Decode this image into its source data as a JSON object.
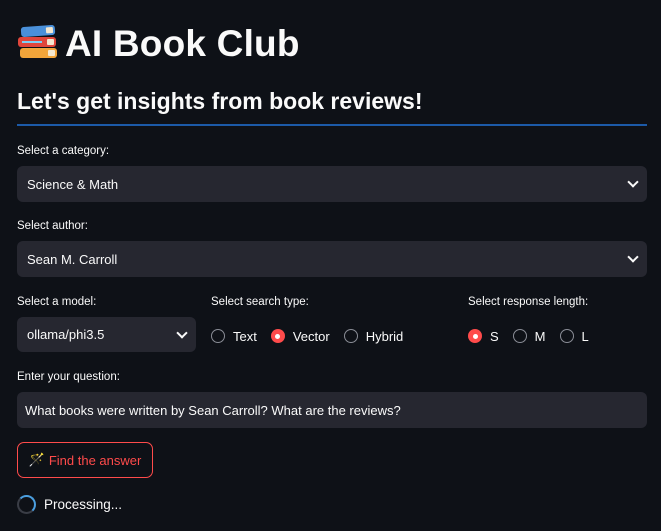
{
  "header": {
    "icon": "books-icon",
    "title": "AI Book Club",
    "subheader": "Let's get insights from book reviews!"
  },
  "category": {
    "label": "Select a category:",
    "value": "Science & Math"
  },
  "author": {
    "label": "Select author:",
    "value": "Sean M. Carroll"
  },
  "model": {
    "label": "Select a model:",
    "value": "ollama/phi3.5"
  },
  "search_type": {
    "label": "Select search type:",
    "options": [
      "Text",
      "Vector",
      "Hybrid"
    ],
    "selected": "Vector"
  },
  "response_length": {
    "label": "Select response length:",
    "options": [
      "S",
      "M",
      "L"
    ],
    "selected": "S"
  },
  "question": {
    "label": "Enter your question:",
    "value": "What books were written by Sean Carroll? What are the reviews?"
  },
  "find_button": {
    "icon": "magic-wand-icon",
    "label": "Find the answer"
  },
  "status": {
    "text": "Processing..."
  },
  "colors": {
    "accent": "#ff4b4b",
    "background": "#0e1117",
    "input_bg": "#262730",
    "divider": "#1c5aa8"
  }
}
